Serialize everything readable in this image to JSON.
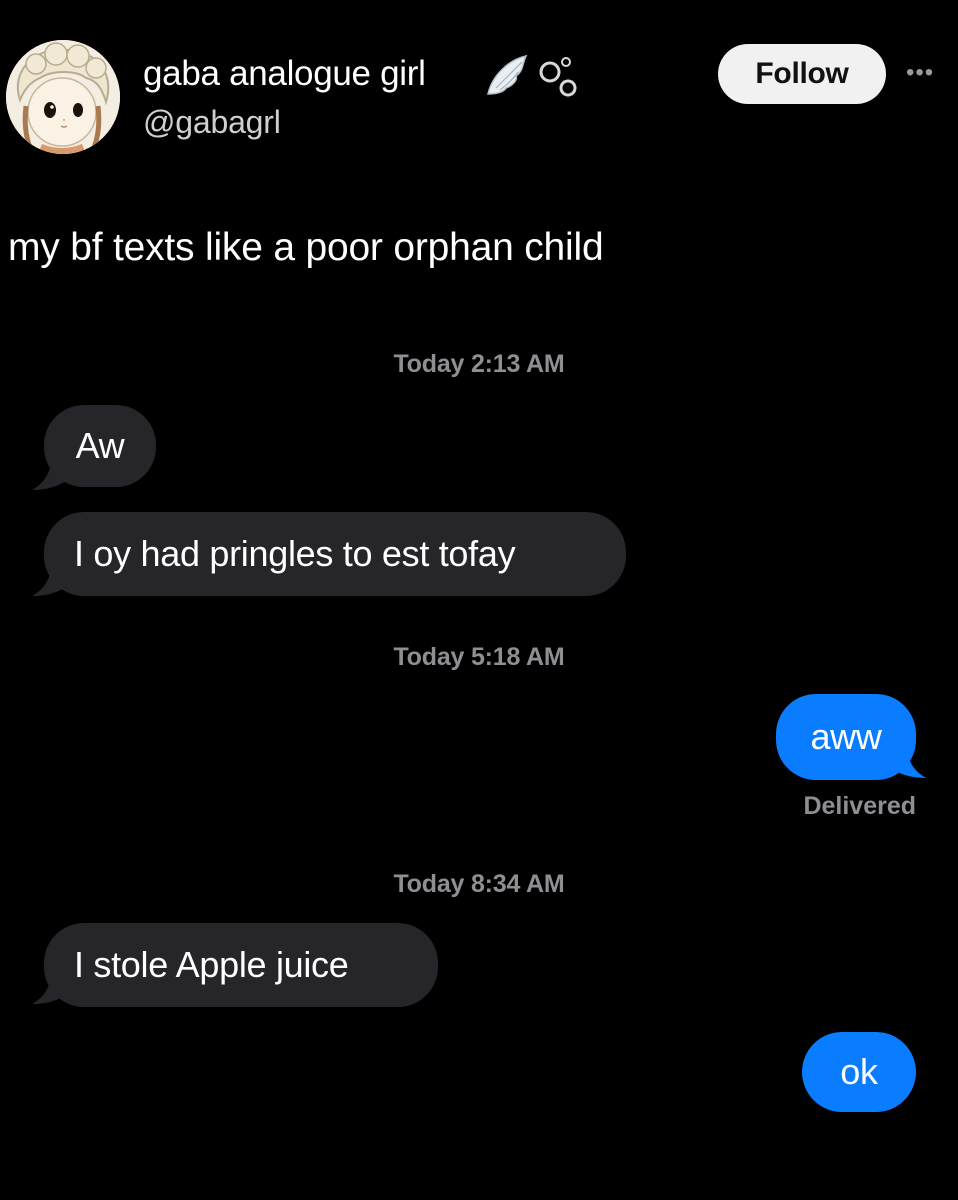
{
  "profile": {
    "display_name": "gaba analogue girl",
    "handle": "@gabagrl",
    "follow_label": "Follow",
    "more_label": "•••"
  },
  "tweet": {
    "text": "my bf texts like a poor orphan child"
  },
  "conversation": {
    "groups": [
      {
        "timestamp": "Today 2:13 AM",
        "messages": [
          {
            "direction": "incoming",
            "text": "Aw"
          },
          {
            "direction": "incoming",
            "text": "I oy had pringles to est tofay"
          }
        ]
      },
      {
        "timestamp": "Today 5:18 AM",
        "messages": [
          {
            "direction": "outgoing",
            "text": "aww"
          }
        ],
        "status": "Delivered"
      },
      {
        "timestamp": "Today 8:34 AM",
        "messages": [
          {
            "direction": "incoming",
            "text": "I stole Apple juice"
          },
          {
            "direction": "outgoing",
            "text": "ok"
          }
        ]
      }
    ]
  },
  "colors": {
    "background": "#000000",
    "incoming_bubble": "#26262a",
    "outgoing_bubble": "#0a7cff",
    "timestamp_text": "#8e8e93"
  },
  "icons": [
    "avatar-illustration",
    "angel-wing-icon",
    "bubbles-icon",
    "more-options-icon"
  ]
}
